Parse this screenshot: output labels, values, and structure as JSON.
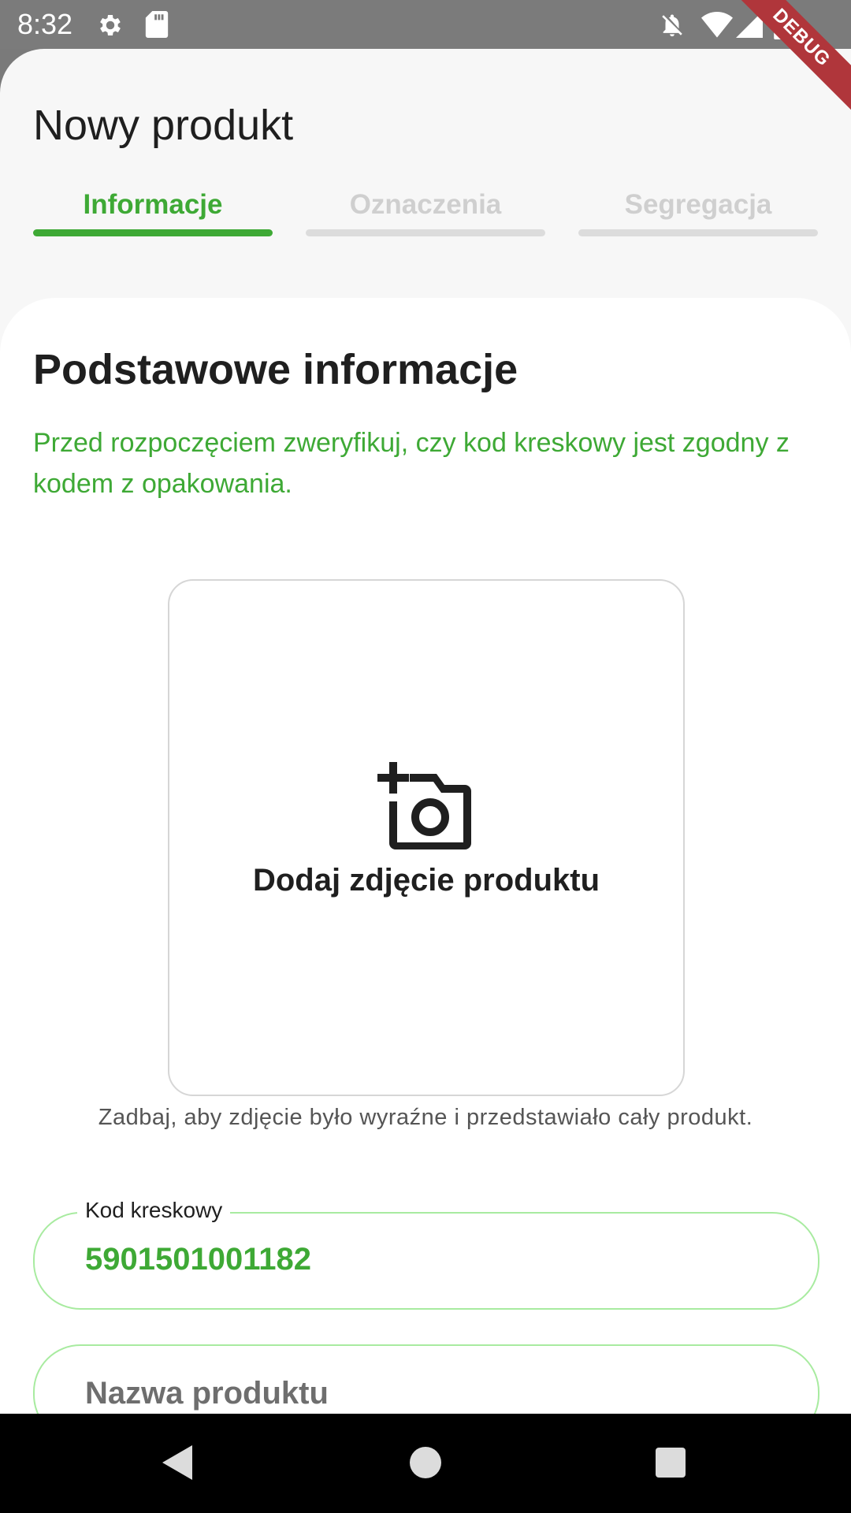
{
  "status_bar": {
    "time": "8:32",
    "icons": [
      "gear-icon",
      "sd-card-icon",
      "notifications-off-icon",
      "wifi-icon",
      "signal-icon",
      "battery-icon"
    ]
  },
  "debug_ribbon": "DEBUG",
  "header": {
    "title": "Nowy produkt"
  },
  "steps": [
    {
      "label": "Informacje",
      "active": true
    },
    {
      "label": "Oznaczenia",
      "active": false
    },
    {
      "label": "Segregacja",
      "active": false
    }
  ],
  "section": {
    "title": "Podstawowe informacje",
    "description": "Przed rozpoczęciem zweryfikuj, czy kod kreskowy jest zgodny z kodem z opakowania."
  },
  "photo": {
    "icon": "add-photo-icon",
    "label": "Dodaj zdjęcie produktu",
    "hint": "Zadbaj, aby zdjęcie było wyraźne i przedstawiało cały produkt."
  },
  "fields": {
    "barcode": {
      "label": "Kod kreskowy",
      "value": "5901501001182"
    },
    "name": {
      "placeholder": "Nazwa produktu"
    }
  },
  "nav": {
    "icons": [
      "back-icon",
      "home-icon",
      "recents-icon"
    ]
  },
  "colors": {
    "accent": "#3ea935",
    "field_border": "#a8eba0",
    "inactive_step": "#dcdcdc",
    "debug": "#b0363b"
  }
}
